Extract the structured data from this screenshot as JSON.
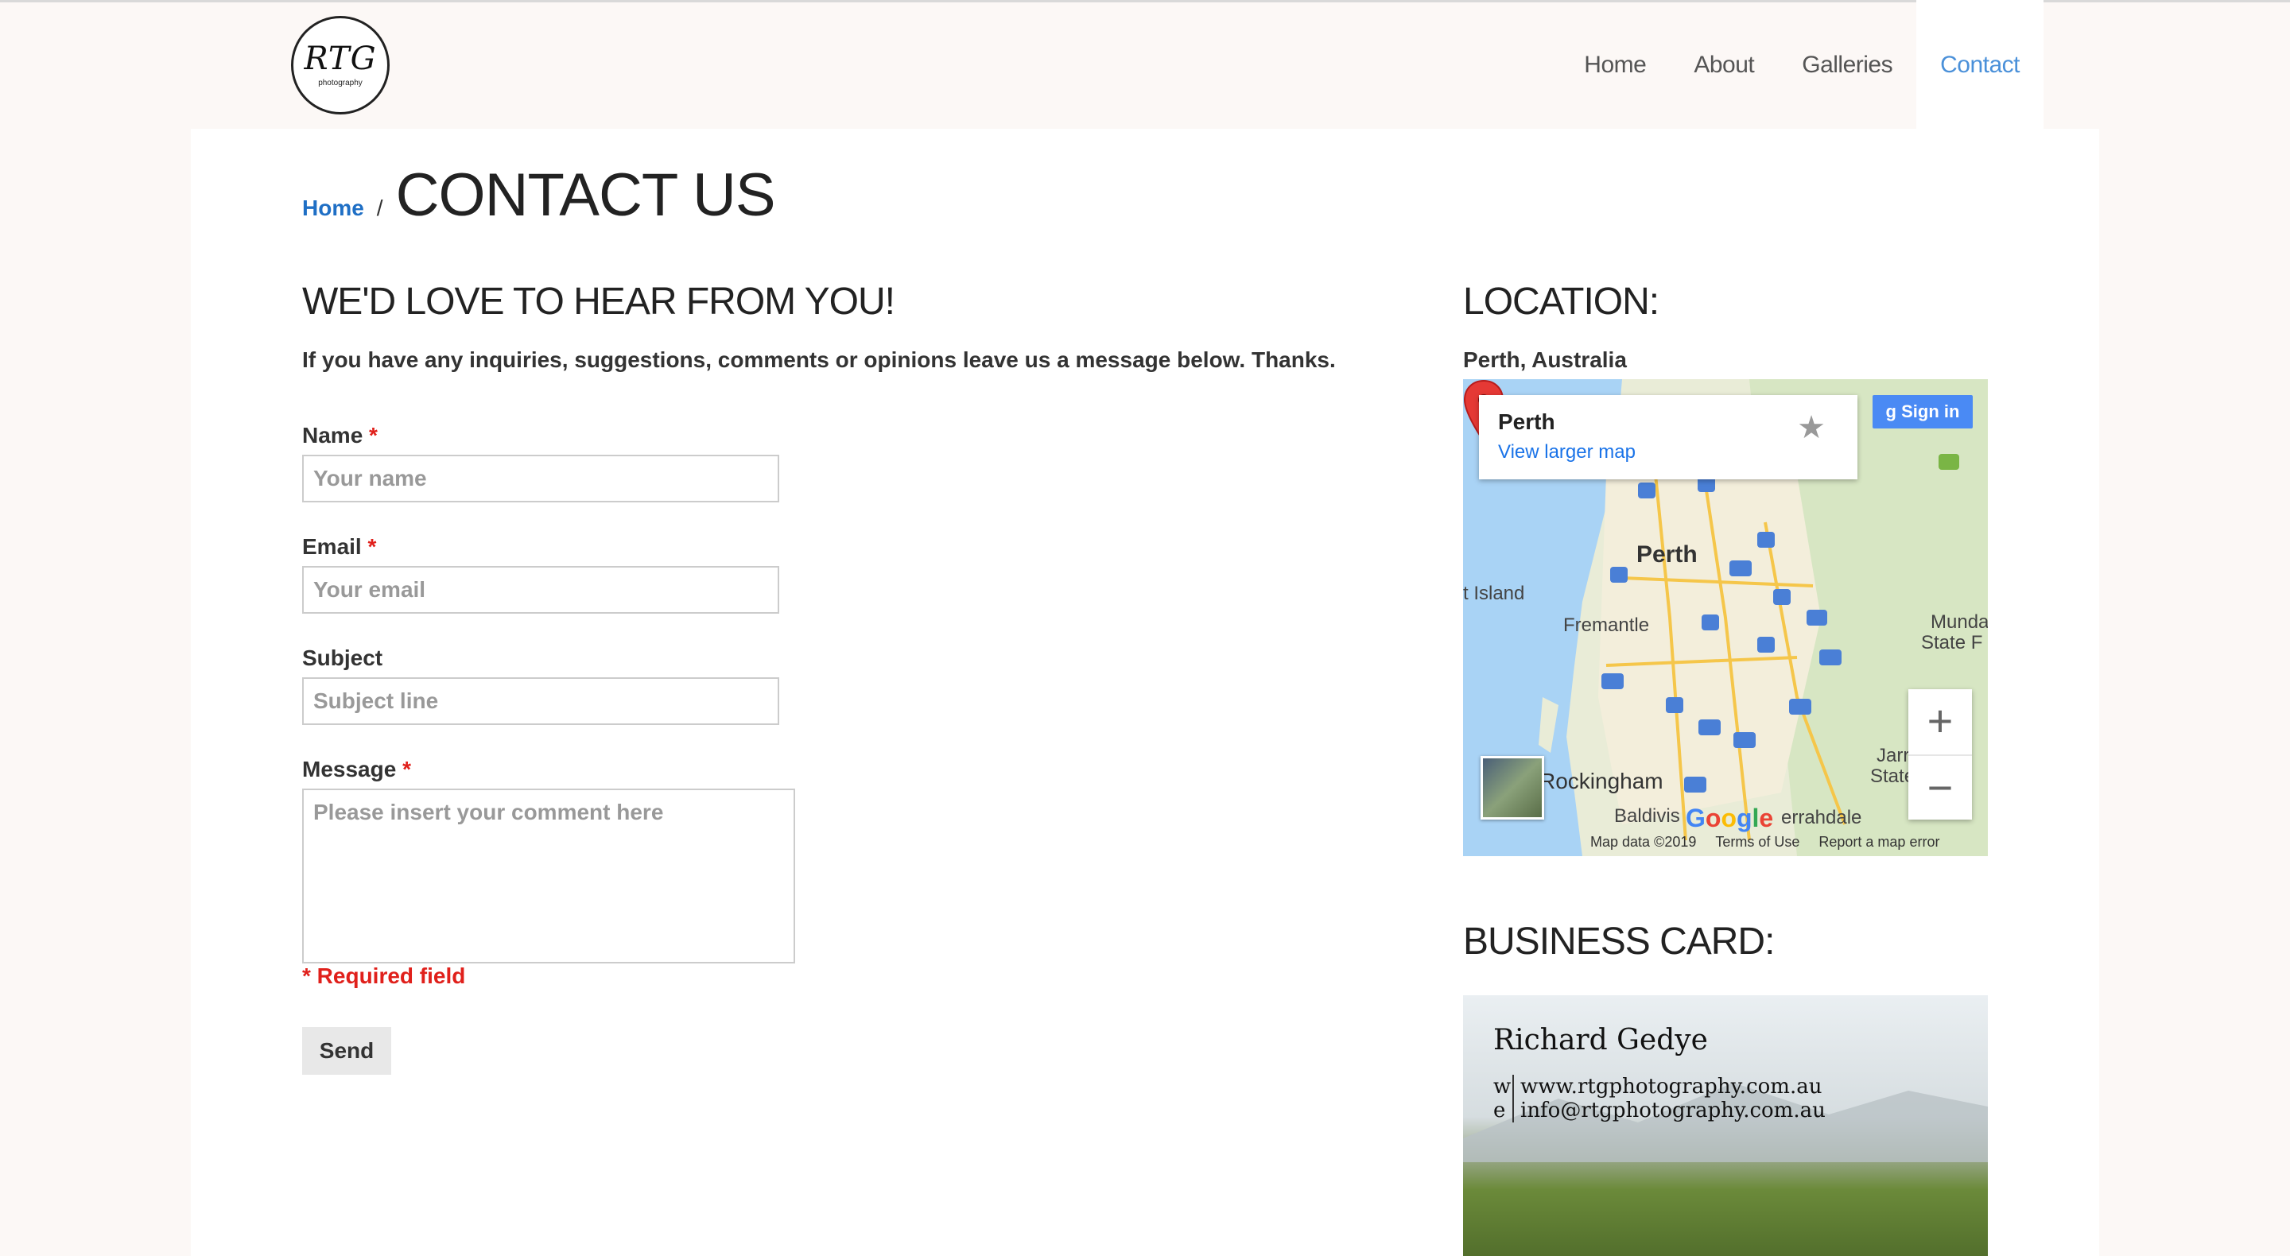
{
  "logo": {
    "monogram": "RTG",
    "subtitle": "photography"
  },
  "nav": {
    "items": [
      {
        "label": "Home"
      },
      {
        "label": "About"
      },
      {
        "label": "Galleries"
      },
      {
        "label": "Contact",
        "active": true
      }
    ]
  },
  "breadcrumb": {
    "home": "Home",
    "separator": "/",
    "title": "CONTACT US"
  },
  "form": {
    "heading": "WE'D LOVE TO HEAR FROM YOU!",
    "intro": "If you have any inquiries, suggestions, comments or opinions leave us a message below. Thanks.",
    "required_marker": "*",
    "name_label": "Name",
    "name_placeholder": "Your name",
    "email_label": "Email",
    "email_placeholder": "Your email",
    "subject_label": "Subject",
    "subject_placeholder": "Subject line",
    "message_label": "Message",
    "message_placeholder": "Please insert your comment here",
    "required_note": "* Required field",
    "send_label": "Send"
  },
  "location": {
    "heading": "LOCATION:",
    "city": "Perth, Australia",
    "map": {
      "card_place": "Perth",
      "card_link": "View larger map",
      "signin": "Sign in",
      "labels": [
        "Perth",
        "Fremantle",
        "t Island",
        "Rockingham",
        "Baldivis",
        "Munda",
        "State F",
        "Jarr",
        "State",
        "errahdale"
      ],
      "route_shields": [
        "3",
        "4",
        "3",
        "55",
        "5",
        "8",
        "41",
        "3",
        "4",
        "40",
        "12",
        "2",
        "30",
        "21",
        "20",
        "22",
        "94"
      ],
      "attribution": [
        "Map data ©2019",
        "Terms of Use",
        "Report a map error"
      ],
      "google": "Google",
      "zoom_in": "+",
      "zoom_out": "−"
    }
  },
  "business_card": {
    "heading": "BUSINESS CARD:",
    "name": "Richard Gedye",
    "web_key": "w",
    "web": "www.rtgphotography.com.au",
    "email_key": "e",
    "email": "info@rtgphotography.com.au"
  },
  "colors": {
    "accent": "#4a90d9",
    "link": "#1f6fc5",
    "required": "#e0201b"
  }
}
